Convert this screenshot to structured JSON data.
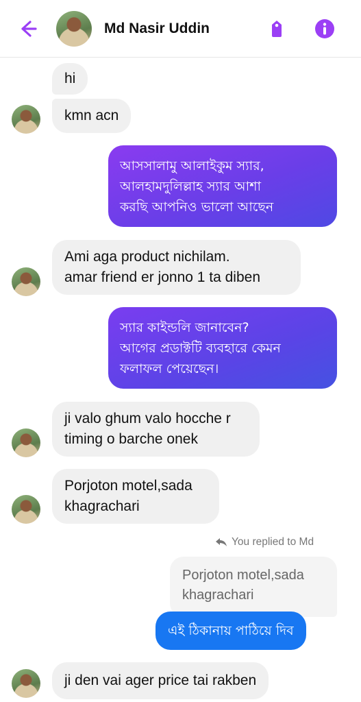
{
  "header": {
    "title": "Md Nasir Uddin",
    "accent_color": "#9b3ff5",
    "icons": [
      "back-arrow-icon",
      "tag-icon",
      "info-icon"
    ]
  },
  "messages": [
    {
      "side": "incoming",
      "lines": [
        "hi"
      ]
    },
    {
      "side": "incoming",
      "lines": [
        "kmn acn"
      ]
    },
    {
      "side": "outgoing",
      "lines": [
        "আসসালামু আলাইকুম স্যার,",
        "আলহামদুলিল্লাহ স্যার আশা",
        "করছি আপনিও ভালো আছেন"
      ]
    },
    {
      "side": "incoming",
      "lines": [
        "Ami aga product nichilam.",
        "amar friend er jonno 1 ta diben"
      ]
    },
    {
      "side": "outgoing",
      "lines": [
        "স্যার কাইন্ডলি জানাবেন?",
        "আগের প্রডাক্টটি ব্যবহারে কেমন",
        "ফলাফল পেয়েছেন।"
      ]
    },
    {
      "side": "incoming",
      "lines": [
        "ji valo ghum valo hocche r",
        "timing o barche onek"
      ]
    },
    {
      "side": "incoming",
      "lines": [
        "Porjoton motel,sada",
        "khagrachari"
      ]
    },
    {
      "side": "outgoing",
      "lines": [
        "এই ঠিকানায় পাঠিয়ে দিব"
      ]
    },
    {
      "side": "incoming",
      "lines": [
        "ji den vai ager price tai rakben"
      ]
    }
  ],
  "reply": {
    "label": "You replied to Md",
    "quoted_lines": [
      "Porjoton motel,sada",
      "khagrachari"
    ]
  },
  "colors": {
    "incoming_bubble": "#f0f0f0",
    "outgoing_gradient_start": "#8a3cf0",
    "outgoing_gradient_end": "#4f49e4",
    "reply_bubble": "#1877f2"
  }
}
